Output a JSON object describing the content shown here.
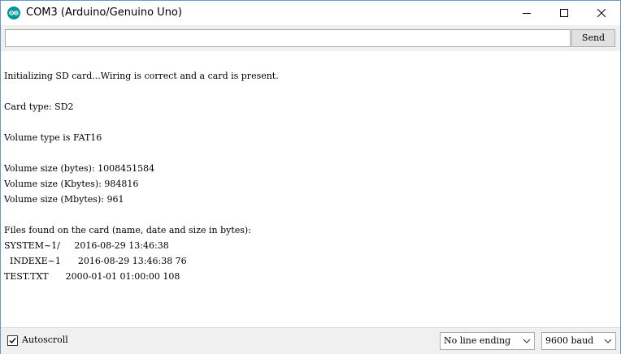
{
  "window": {
    "title": "COM3 (Arduino/Genuino Uno)",
    "icon": "arduino-logo-icon",
    "controls": [
      "minimize-icon",
      "maximize-icon",
      "close-icon"
    ]
  },
  "input": {
    "value": "",
    "send_label": "Send"
  },
  "output": {
    "lines": [
      "Initializing SD card...Wiring is correct and a card is present.",
      "Card type: SD2",
      "Volume type is FAT16",
      "Volume size (bytes): 1008451584",
      "Volume size (Kbytes): 984816",
      "Volume size (Mbytes): 961",
      "Files found on the card (name, date and size in bytes):",
      "SYSTEM~1/     2016-08-29 13:46:38",
      "  INDEXE~1      2016-08-29 13:46:38 76",
      "TEST.TXT      2000-01-01 01:00:00 108"
    ]
  },
  "footer": {
    "autoscroll_label": "Autoscroll",
    "autoscroll_checked": true,
    "line_ending_value": "No line ending",
    "baud_value": "9600 baud"
  },
  "colors": {
    "accent": "#00979d",
    "window_border": "#6a98c6",
    "toolbar_bg": "#f0f0f0"
  }
}
